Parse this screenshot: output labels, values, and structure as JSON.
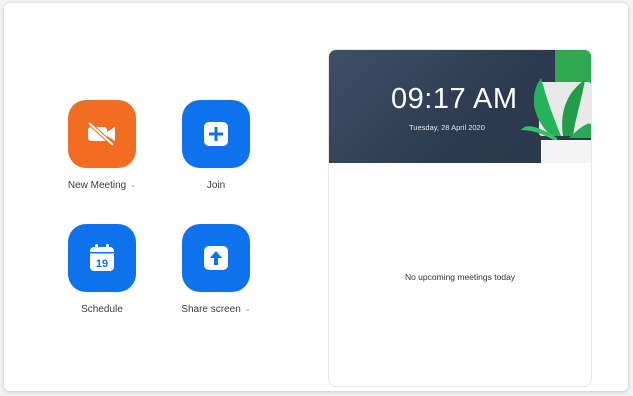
{
  "colors": {
    "orange": "#f26d21",
    "blue": "#0e72ed",
    "banner": "#2f3e52"
  },
  "actions": {
    "new_meeting": {
      "label": "New Meeting",
      "icon": "video-off-icon",
      "has_dropdown": true
    },
    "join": {
      "label": "Join",
      "icon": "plus-icon"
    },
    "schedule": {
      "label": "Schedule",
      "icon": "calendar-icon",
      "day": "19"
    },
    "share_screen": {
      "label": "Share screen",
      "icon": "upload-arrow-icon",
      "has_dropdown": true
    }
  },
  "caret": "⌄",
  "panel": {
    "time": "09:17 AM",
    "date": "Tuesday, 28 April 2020",
    "empty_text": "No upcoming meetings today"
  }
}
